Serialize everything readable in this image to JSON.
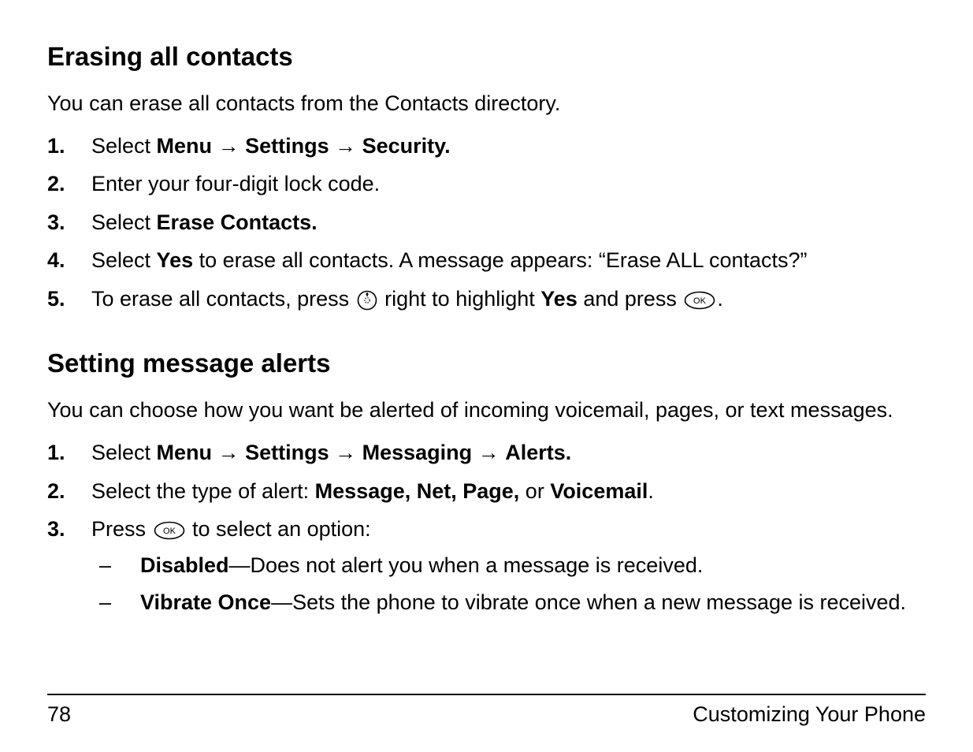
{
  "section1": {
    "heading": "Erasing all contacts",
    "intro": "You can erase all contacts from the Contacts directory.",
    "step1_num": "1.",
    "step1_pre": "Select ",
    "step1_menu": "Menu",
    "step1_settings": "Settings",
    "step1_security": "Security.",
    "step2_num": "2.",
    "step2_text": "Enter your four-digit lock code.",
    "step3_num": "3.",
    "step3_pre": "Select ",
    "step3_bold": "Erase Contacts.",
    "step4_num": "4.",
    "step4_pre": "Select ",
    "step4_bold": "Yes",
    "step4_post": " to erase all contacts. A message appears: “Erase ALL contacts?”",
    "step5_num": "5.",
    "step5_pre": "To erase all contacts, press ",
    "step5_mid": " right to highlight ",
    "step5_bold": "Yes",
    "step5_mid2": " and press ",
    "step5_end": "."
  },
  "section2": {
    "heading": "Setting message alerts",
    "intro": "You can choose how you want be alerted of incoming voicemail, pages, or text messages.",
    "step1_num": "1.",
    "step1_pre": "Select ",
    "step1_menu": "Menu",
    "step1_settings": "Settings",
    "step1_messaging": "Messaging",
    "step1_alerts": "Alerts.",
    "step2_num": "2.",
    "step2_pre": "Select the type of alert: ",
    "step2_bold": "Message, Net, Page,",
    "step2_mid": " or ",
    "step2_bold2": "Voicemail",
    "step2_end": ".",
    "step3_num": "3.",
    "step3_pre": "Press ",
    "step3_post": " to select an option:",
    "sub1_bold": "Disabled",
    "sub1_rest": "—Does not alert you when a message is received.",
    "sub2_bold": "Vibrate Once",
    "sub2_rest": "—Sets the phone to vibrate once when a new message is received."
  },
  "glyphs": {
    "arrow": "→",
    "dash": "–"
  },
  "footer": {
    "page": "78",
    "chapter": "Customizing Your Phone"
  }
}
